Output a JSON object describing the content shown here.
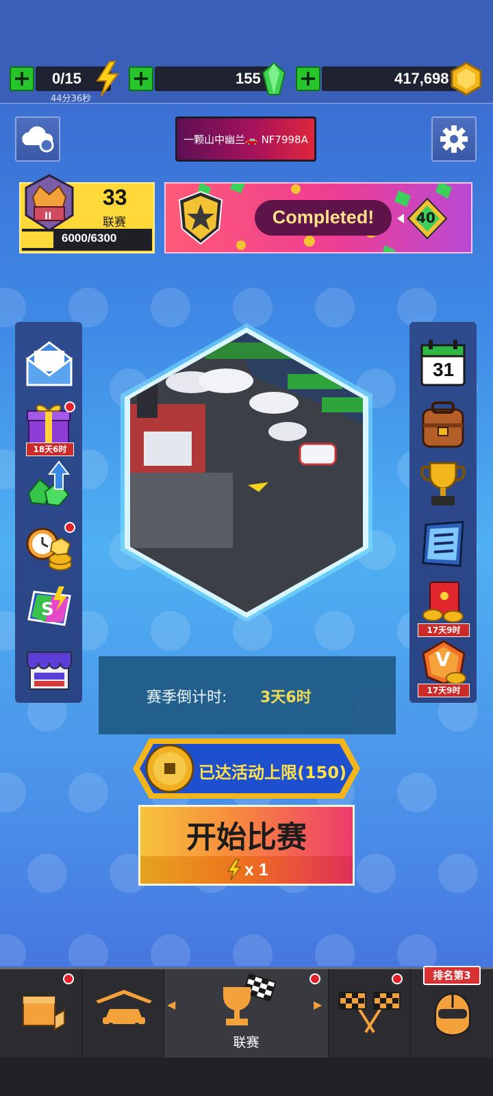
{
  "resources": {
    "energy": {
      "value": "0/15",
      "timer": "44分36秒",
      "icon": "lightning-icon"
    },
    "gems": {
      "value": "155",
      "icon": "green-gem-icon"
    },
    "coins": {
      "value": "417,698",
      "icon": "gold-coin-icon"
    },
    "add_icon": "plus-icon"
  },
  "header": {
    "cloud_sync_icon": "cloud-sync-icon",
    "player_name": "一颗山中幽兰🚗 NF7998A",
    "settings_icon": "gear-icon"
  },
  "league": {
    "level": "33",
    "label": "联赛",
    "progress_text": "6000/6300",
    "progress_fraction": 0.952,
    "badge_icon": "crown-rank-badge-icon",
    "badge_rank": "II"
  },
  "banner": {
    "status": "Completed!",
    "reward": "40",
    "star_icon": "star-shield-icon"
  },
  "left_menu": [
    {
      "id": "mail",
      "icon": "mail-icon"
    },
    {
      "id": "gift",
      "icon": "gift-box-icon",
      "timer": "18天6时",
      "dot": true
    },
    {
      "id": "gem-upgrade",
      "icon": "gem-arrow-icon"
    },
    {
      "id": "offline-coins",
      "icon": "clock-coins-icon",
      "dot": true
    },
    {
      "id": "season-pass",
      "icon": "s-pass-card-icon"
    },
    {
      "id": "shop",
      "icon": "shop-icon"
    }
  ],
  "right_menu": [
    {
      "id": "calendar",
      "icon": "calendar-icon",
      "day": "31"
    },
    {
      "id": "backpack",
      "icon": "backpack-icon"
    },
    {
      "id": "trophy",
      "icon": "trophy-icon"
    },
    {
      "id": "checklist",
      "icon": "checklist-icon"
    },
    {
      "id": "red-envelope",
      "icon": "red-envelope-icon",
      "timer": "17天9时"
    },
    {
      "id": "vip",
      "icon": "vip-badge-icon",
      "letter": "V",
      "timer": "17天9时"
    }
  ],
  "season": {
    "label": "赛季倒计时:",
    "value": "3天6时"
  },
  "activity": {
    "text": "已达活动上限(150)",
    "coin_icon": "ancient-coin-icon"
  },
  "start": {
    "label": "开始比赛",
    "cost": "x 1",
    "icon": "lightning-icon"
  },
  "nav": [
    {
      "id": "store",
      "icon": "store-box-icon",
      "dot": true
    },
    {
      "id": "garage",
      "icon": "garage-car-icon"
    },
    {
      "id": "league",
      "icon": "trophy-flag-icon",
      "label": "联赛",
      "active": true,
      "dot": true
    },
    {
      "id": "race",
      "icon": "checkered-flags-icon",
      "dot": true
    },
    {
      "id": "ranking",
      "icon": "racer-helmet-icon",
      "tag": "排名第3"
    }
  ]
}
